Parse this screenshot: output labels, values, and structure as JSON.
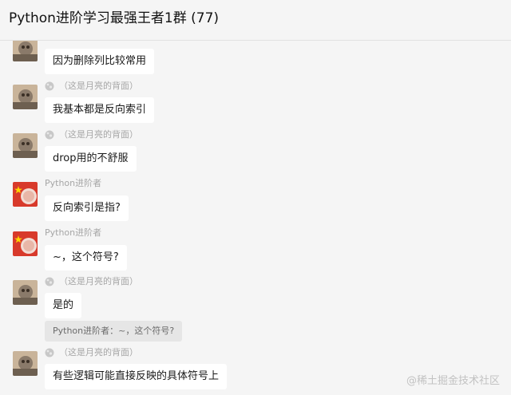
{
  "header": {
    "title": "Python进阶学习最强王者1群 (77)"
  },
  "messages": [
    {
      "sender": "",
      "text": "因为删除列比较常用"
    },
    {
      "sender": "（这是月亮的背面）",
      "text": "我基本都是反向索引"
    },
    {
      "sender": "（这是月亮的背面）",
      "text": "drop用的不舒服"
    },
    {
      "sender": "Python进阶者",
      "text": "反向索引是指?"
    },
    {
      "sender": "Python进阶者",
      "text": "~，这个符号?"
    },
    {
      "sender": "（这是月亮的背面）",
      "text": "是的",
      "quote": "Python进阶者：~，这个符号?"
    },
    {
      "sender": "（这是月亮的背面）",
      "text": "有些逻辑可能直接反映的具体符号上"
    }
  ],
  "watermark": "@稀土掘金技术社区",
  "colors": {
    "background": "#f5f5f5",
    "bubble": "#ffffff",
    "quote": "#e6e6e6",
    "sender": "#a6a6a6"
  }
}
